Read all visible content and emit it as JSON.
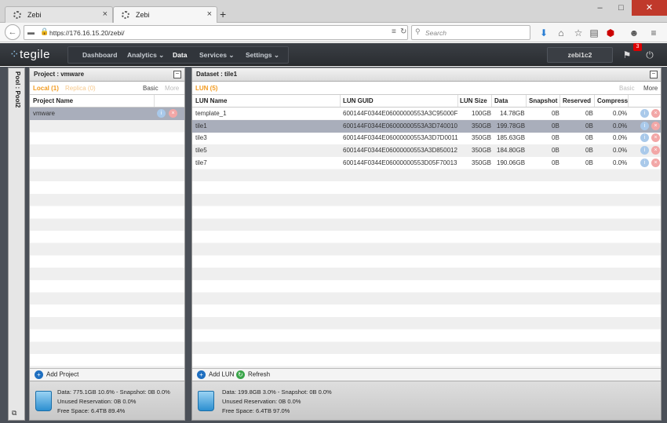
{
  "browser": {
    "tabs": [
      {
        "title": "Zebi",
        "close": "×"
      },
      {
        "title": "Zebi",
        "close": "×"
      }
    ],
    "new_tab": "+",
    "window_controls": {
      "minimize": "–",
      "maximize": "□",
      "close": "✕"
    },
    "url": "https://176.16.15.20/zebi/",
    "search_placeholder": "Search"
  },
  "app": {
    "logo_text": "tegile",
    "menu": [
      {
        "label": "Dashboard"
      },
      {
        "label": "Analytics ⌄"
      },
      {
        "label": "Data"
      },
      {
        "label": "Services ⌄"
      },
      {
        "label": "Settings ⌄"
      }
    ],
    "user": "zebi1c2",
    "alert_count": "3",
    "pool_label": "Pool : Pool2"
  },
  "project_panel": {
    "title": "Project : vmware",
    "tabs": {
      "local": "Local (1)",
      "replica": "Replica (0)",
      "basic": "Basic",
      "more": "More"
    },
    "column": "Project Name",
    "rows": [
      {
        "name": "vmware"
      }
    ],
    "add_label": "Add Project",
    "stats": {
      "line1": "Data: 775.1GB 10.6% - Snapshot: 0B 0.0%",
      "line2": "Unused Reservation: 0B 0.0%",
      "line3": "Free Space: 6.4TB 89.4%"
    }
  },
  "dataset_panel": {
    "title": "Dataset : tile1",
    "tabs": {
      "lun": "LUN (5)",
      "basic": "Basic",
      "more": "More"
    },
    "columns": {
      "name": "LUN Name",
      "guid": "LUN GUID",
      "size": "LUN Size",
      "data": "Data",
      "snapshot": "Snapshot",
      "reserved": "Reserved",
      "compress": "Compress"
    },
    "rows": [
      {
        "name": "template_1",
        "guid": "600144F0344E06000000553A3C95000F",
        "size": "100GB",
        "data": "14.78GB",
        "snapshot": "0B",
        "reserved": "0B",
        "compress": "0.0%"
      },
      {
        "name": "tile1",
        "guid": "600144F0344E06000000553A3D740010",
        "size": "350GB",
        "data": "199.78GB",
        "snapshot": "0B",
        "reserved": "0B",
        "compress": "0.0%"
      },
      {
        "name": "tile3",
        "guid": "600144F0344E06000000553A3D7D0011",
        "size": "350GB",
        "data": "185.63GB",
        "snapshot": "0B",
        "reserved": "0B",
        "compress": "0.0%"
      },
      {
        "name": "tile5",
        "guid": "600144F0344E06000000553A3D850012",
        "size": "350GB",
        "data": "184.80GB",
        "snapshot": "0B",
        "reserved": "0B",
        "compress": "0.0%"
      },
      {
        "name": "tile7",
        "guid": "600144F0344E06000000553D05F70013",
        "size": "350GB",
        "data": "190.06GB",
        "snapshot": "0B",
        "reserved": "0B",
        "compress": "0.0%"
      }
    ],
    "add_label": "Add LUN",
    "refresh_label": "Refresh",
    "stats": {
      "line1": "Data: 199.8GB 3.0% - Snapshot: 0B 0.0%",
      "line2": "Unused Reservation: 0B 0.0%",
      "line3": "Free Space: 6.4TB 97.0%"
    }
  }
}
